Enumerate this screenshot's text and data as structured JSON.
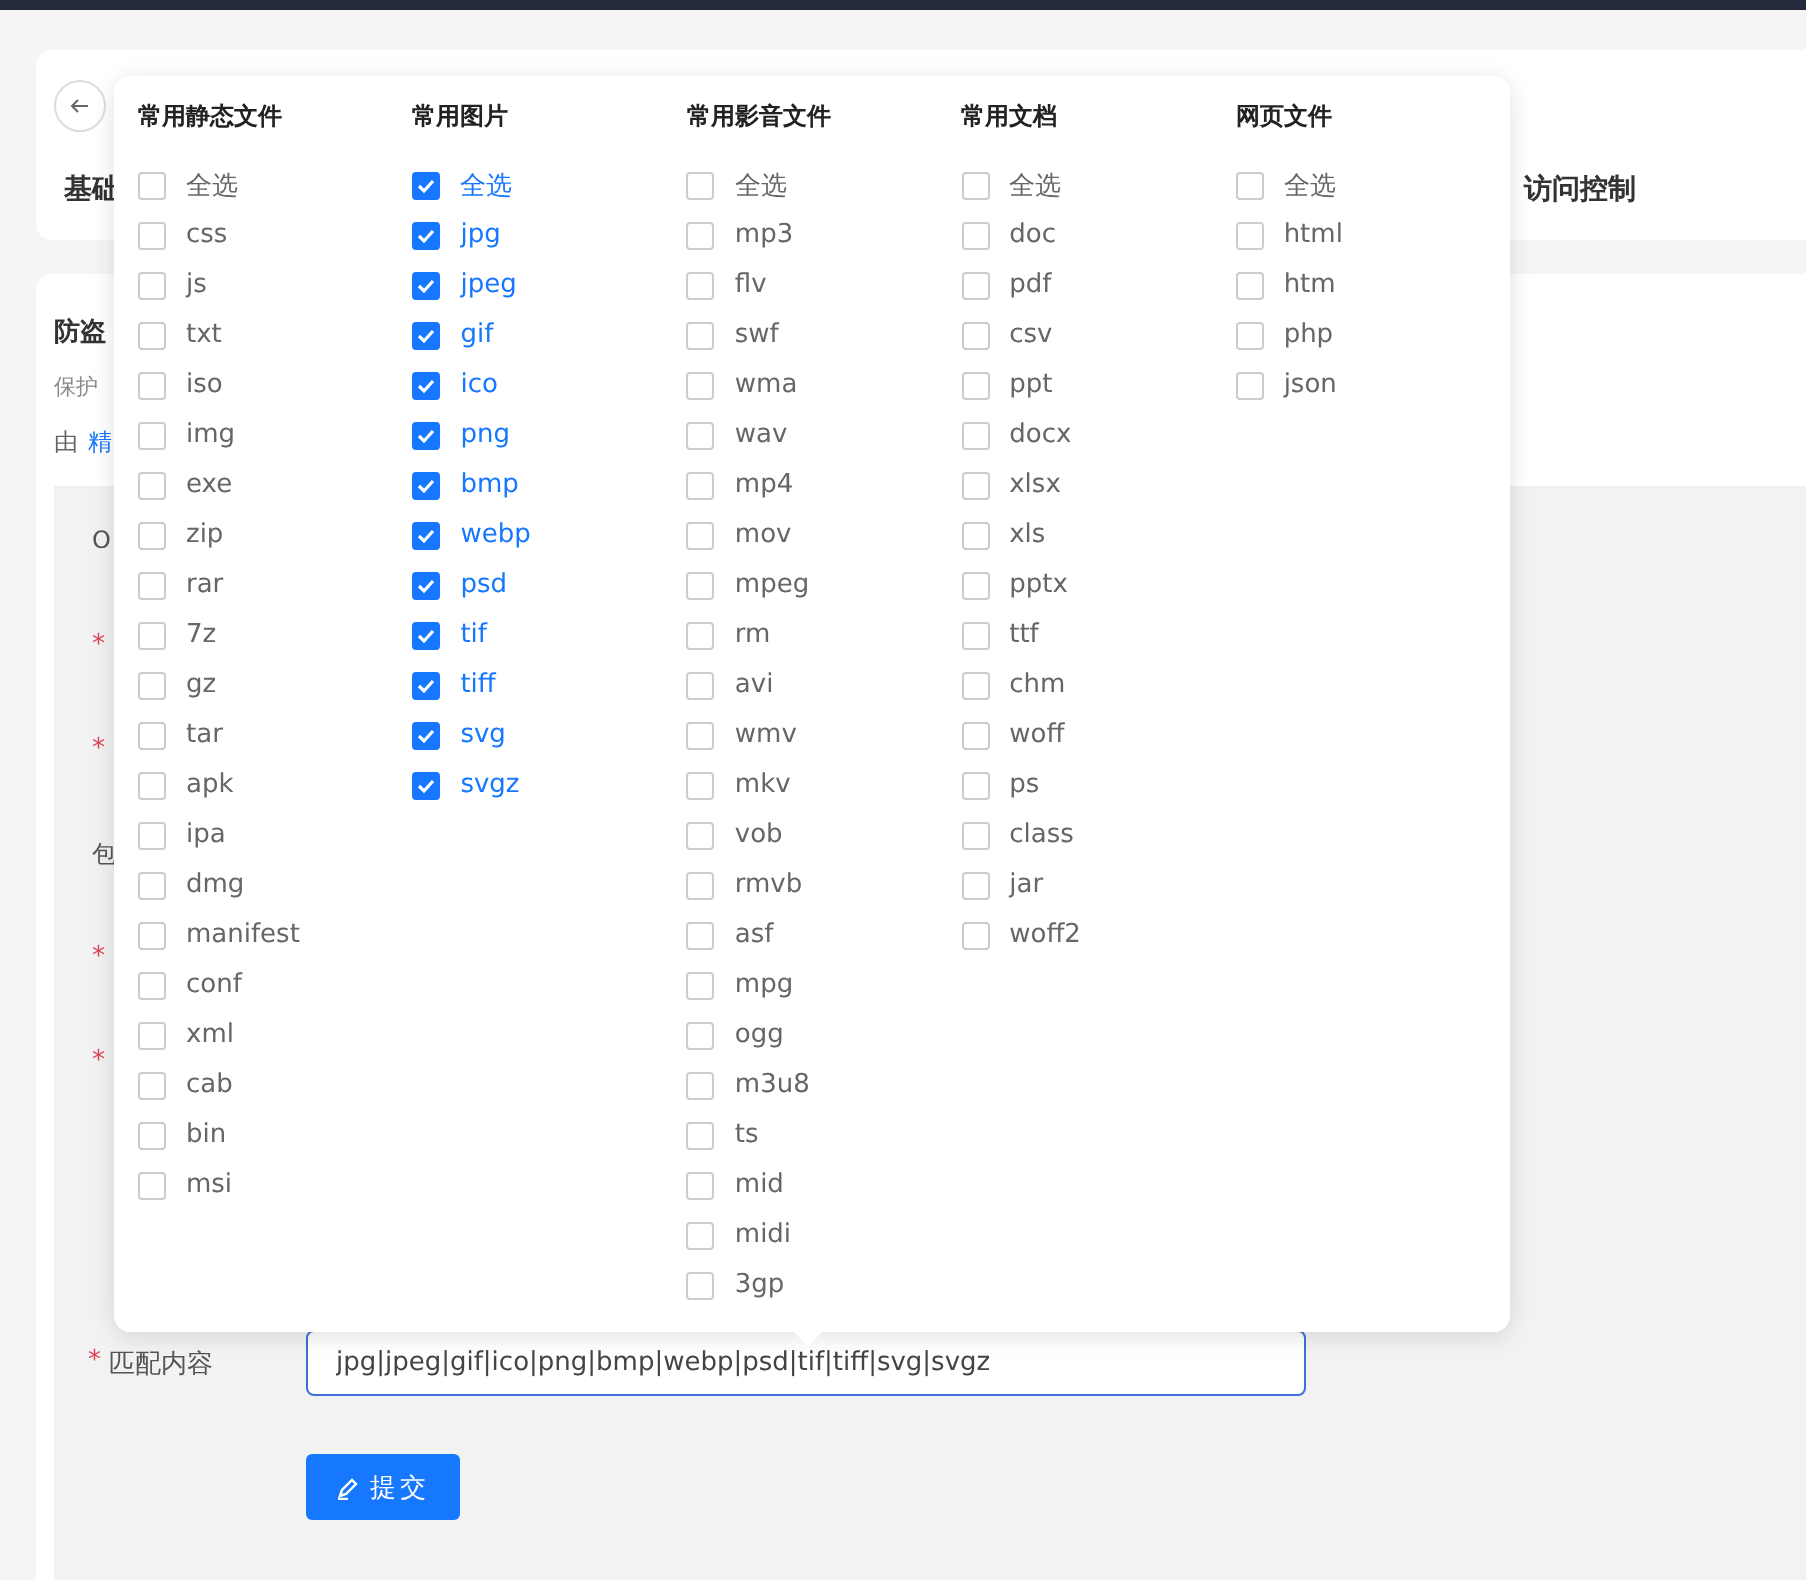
{
  "header_card": {
    "tabs": [
      "基础",
      "访问控制"
    ]
  },
  "section": {
    "title": "防盗",
    "description": "保护",
    "source_prefix": "由",
    "source_link": "精"
  },
  "form": {
    "rows": [
      {
        "label": "O"
      },
      {
        "required_mark": "*"
      },
      {
        "required_mark": "*"
      },
      {
        "label": "包"
      },
      {
        "required_mark": "*"
      },
      {
        "required_mark": "*"
      }
    ],
    "match_field": {
      "required_mark": "*",
      "label": "匹配内容",
      "value": "jpg|jpeg|gif|ico|png|bmp|webp|psd|tif|tiff|svg|svgz"
    },
    "submit_button": {
      "label": "提交"
    }
  },
  "popover": {
    "columns": [
      {
        "title": "常用静态文件",
        "select_all": {
          "label": "全选",
          "checked": false
        },
        "options": [
          {
            "label": "css",
            "checked": false
          },
          {
            "label": "js",
            "checked": false
          },
          {
            "label": "txt",
            "checked": false
          },
          {
            "label": "iso",
            "checked": false
          },
          {
            "label": "img",
            "checked": false
          },
          {
            "label": "exe",
            "checked": false
          },
          {
            "label": "zip",
            "checked": false
          },
          {
            "label": "rar",
            "checked": false
          },
          {
            "label": "7z",
            "checked": false
          },
          {
            "label": "gz",
            "checked": false
          },
          {
            "label": "tar",
            "checked": false
          },
          {
            "label": "apk",
            "checked": false
          },
          {
            "label": "ipa",
            "checked": false
          },
          {
            "label": "dmg",
            "checked": false
          },
          {
            "label": "manifest",
            "checked": false
          },
          {
            "label": "conf",
            "checked": false
          },
          {
            "label": "xml",
            "checked": false
          },
          {
            "label": "cab",
            "checked": false
          },
          {
            "label": "bin",
            "checked": false
          },
          {
            "label": "msi",
            "checked": false
          }
        ]
      },
      {
        "title": "常用图片",
        "select_all": {
          "label": "全选",
          "checked": true
        },
        "options": [
          {
            "label": "jpg",
            "checked": true
          },
          {
            "label": "jpeg",
            "checked": true
          },
          {
            "label": "gif",
            "checked": true
          },
          {
            "label": "ico",
            "checked": true
          },
          {
            "label": "png",
            "checked": true
          },
          {
            "label": "bmp",
            "checked": true
          },
          {
            "label": "webp",
            "checked": true
          },
          {
            "label": "psd",
            "checked": true
          },
          {
            "label": "tif",
            "checked": true
          },
          {
            "label": "tiff",
            "checked": true
          },
          {
            "label": "svg",
            "checked": true
          },
          {
            "label": "svgz",
            "checked": true
          }
        ]
      },
      {
        "title": "常用影音文件",
        "select_all": {
          "label": "全选",
          "checked": false
        },
        "options": [
          {
            "label": "mp3",
            "checked": false
          },
          {
            "label": "flv",
            "checked": false
          },
          {
            "label": "swf",
            "checked": false
          },
          {
            "label": "wma",
            "checked": false
          },
          {
            "label": "wav",
            "checked": false
          },
          {
            "label": "mp4",
            "checked": false
          },
          {
            "label": "mov",
            "checked": false
          },
          {
            "label": "mpeg",
            "checked": false
          },
          {
            "label": "rm",
            "checked": false
          },
          {
            "label": "avi",
            "checked": false
          },
          {
            "label": "wmv",
            "checked": false
          },
          {
            "label": "mkv",
            "checked": false
          },
          {
            "label": "vob",
            "checked": false
          },
          {
            "label": "rmvb",
            "checked": false
          },
          {
            "label": "asf",
            "checked": false
          },
          {
            "label": "mpg",
            "checked": false
          },
          {
            "label": "ogg",
            "checked": false
          },
          {
            "label": "m3u8",
            "checked": false
          },
          {
            "label": "ts",
            "checked": false
          },
          {
            "label": "mid",
            "checked": false
          },
          {
            "label": "midi",
            "checked": false
          },
          {
            "label": "3gp",
            "checked": false
          }
        ]
      },
      {
        "title": "常用文档",
        "select_all": {
          "label": "全选",
          "checked": false
        },
        "options": [
          {
            "label": "doc",
            "checked": false
          },
          {
            "label": "pdf",
            "checked": false
          },
          {
            "label": "csv",
            "checked": false
          },
          {
            "label": "ppt",
            "checked": false
          },
          {
            "label": "docx",
            "checked": false
          },
          {
            "label": "xlsx",
            "checked": false
          },
          {
            "label": "xls",
            "checked": false
          },
          {
            "label": "pptx",
            "checked": false
          },
          {
            "label": "ttf",
            "checked": false
          },
          {
            "label": "chm",
            "checked": false
          },
          {
            "label": "woff",
            "checked": false
          },
          {
            "label": "ps",
            "checked": false
          },
          {
            "label": "class",
            "checked": false
          },
          {
            "label": "jar",
            "checked": false
          },
          {
            "label": "woff2",
            "checked": false
          }
        ]
      },
      {
        "title": "网页文件",
        "select_all": {
          "label": "全选",
          "checked": false
        },
        "options": [
          {
            "label": "html",
            "checked": false
          },
          {
            "label": "htm",
            "checked": false
          },
          {
            "label": "php",
            "checked": false
          },
          {
            "label": "json",
            "checked": false
          }
        ]
      }
    ]
  }
}
